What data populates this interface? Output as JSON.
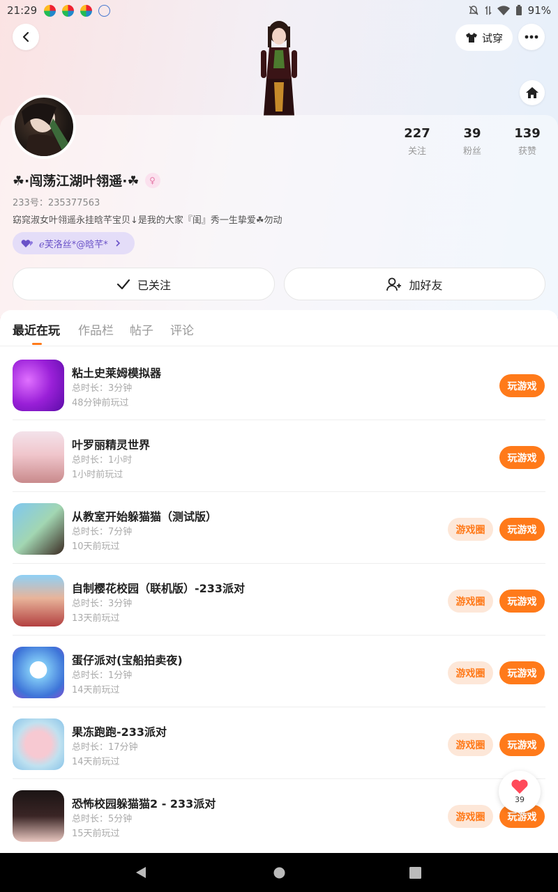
{
  "status_bar": {
    "time": "21:29",
    "battery": "91%"
  },
  "header": {
    "tryon_label": "试穿"
  },
  "profile": {
    "stats": [
      {
        "num": "227",
        "label": "关注"
      },
      {
        "num": "39",
        "label": "粉丝"
      },
      {
        "num": "139",
        "label": "获赞"
      }
    ],
    "nickname": "☘·闯荡江湖叶翎遥·☘",
    "uid": "233号：235377563",
    "bio": "窈窕淑女叶翎遥永挂晗芊宝贝↓是我的大家『闺』秀一生挚爱☘勿动",
    "relation": "ℯ芙洛丝*@晗芊*",
    "follow_label": "已关注",
    "add_friend_label": "加好友"
  },
  "tabs": [
    "最近在玩",
    "作品栏",
    "帖子",
    "评论"
  ],
  "games": [
    {
      "name": "粘土史莱姆模拟器",
      "duration": "总时长：3分钟",
      "last_played": "48分钟前玩过",
      "has_circle": false
    },
    {
      "name": "叶罗丽精灵世界",
      "duration": "总时长：1小时",
      "last_played": "1小时前玩过",
      "has_circle": false
    },
    {
      "name": "从教室开始躲猫猫（测试版）",
      "duration": "总时长：7分钟",
      "last_played": "10天前玩过",
      "has_circle": true
    },
    {
      "name": "自制樱花校园（联机版）-233派对",
      "duration": "总时长：3分钟",
      "last_played": "13天前玩过",
      "has_circle": true
    },
    {
      "name": "蛋仔派对(宝船拍卖夜)",
      "duration": "总时长：1分钟",
      "last_played": "14天前玩过",
      "has_circle": true
    },
    {
      "name": "果冻跑跑-233派对",
      "duration": "总时长：17分钟",
      "last_played": "14天前玩过",
      "has_circle": true
    },
    {
      "name": "恐怖校园躲猫猫2 - 233派对",
      "duration": "总时长：5分钟",
      "last_played": "15天前玩过",
      "has_circle": true
    }
  ],
  "buttons": {
    "play_label": "玩游戏",
    "circle_label": "游戏圈"
  },
  "like_fab": {
    "count": "39"
  },
  "colors": {
    "accent": "#ff7a1a",
    "accent_soft": "#fde7d8",
    "relation_bg": "#e4ddf8"
  }
}
